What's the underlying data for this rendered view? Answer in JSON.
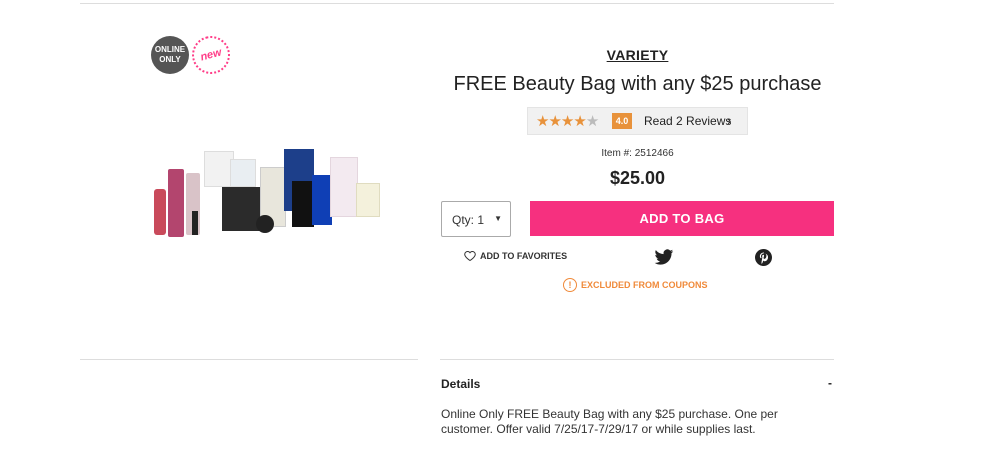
{
  "badges": {
    "online_only": "ONLINE ONLY",
    "new": "new"
  },
  "product": {
    "brand": "VARIETY",
    "title": "FREE Beauty Bag with any $25 purchase",
    "rating": {
      "stars_filled": 4,
      "stars_total": 5,
      "value": "4.0",
      "reviews_label": "Read 2 Reviews"
    },
    "item_number": "Item #: 2512466",
    "price": "$25.00"
  },
  "purchase": {
    "qty_label": "Qty: 1",
    "add_to_bag": "ADD TO BAG"
  },
  "actions": {
    "favorites": "ADD TO FAVORITES",
    "twitter_icon": "twitter-icon",
    "pinterest_icon": "pinterest-icon"
  },
  "notice": {
    "excluded": "EXCLUDED FROM COUPONS"
  },
  "details": {
    "heading": "Details",
    "toggle": "-",
    "body": "Online Only FREE Beauty Bag with any $25 purchase. One per customer. Offer valid 7/25/17-7/29/17 or while supplies last."
  },
  "colors": {
    "accent": "#f6307f",
    "rating": "#e8923b",
    "coupon": "#f08a3a"
  }
}
